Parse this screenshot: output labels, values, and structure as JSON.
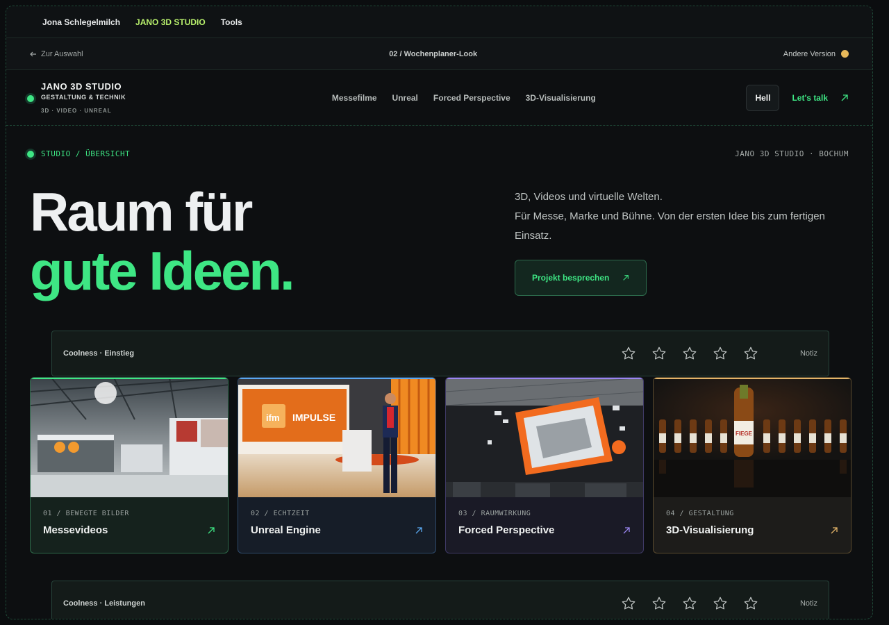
{
  "topbar": {
    "item1": "Jona Schlegelmilch",
    "item2": "JANO 3D STUDIO",
    "item3": "Tools"
  },
  "verbar": {
    "back": "Zur Auswahl",
    "title": "02 / Wochenplaner-Look",
    "version": "Andere Version"
  },
  "brand": {
    "name": "JANO 3D STUDIO",
    "sub": "GESTALTUNG & TECHNIK",
    "tags": "3D · VIDEO · UNREAL"
  },
  "nav": [
    "Messefilme",
    "Unreal",
    "Forced Perspective",
    "3D-Visualisierung"
  ],
  "header": {
    "theme_label": "Hell",
    "cta": "Let's talk"
  },
  "section": {
    "left": "STUDIO / ÜBERSICHT",
    "right": "JANO 3D STUDIO · BOCHUM"
  },
  "hero": {
    "line1": "Raum für",
    "line2": "gute Ideen.",
    "lead1": "3D, Videos und virtuelle Welten.",
    "lead2": "Für Messe, Marke und Bühne. Von der ersten Idee bis zum fertigen Einsatz.",
    "cta": "Projekt besprechen"
  },
  "rating1": {
    "label": "Coolness · Einstieg",
    "note": "Notiz",
    "stars": 0
  },
  "rating2": {
    "label": "Coolness · Leistungen",
    "note": "Notiz",
    "stars": 0
  },
  "cards": [
    {
      "kicker": "01 / BEWEGTE BILDER",
      "title": "Messevideos",
      "accent": "#3ee684"
    },
    {
      "kicker": "02 / ECHTZEIT",
      "title": "Unreal Engine",
      "accent": "#5aa8f0"
    },
    {
      "kicker": "03 / RAUMWIRKUNG",
      "title": "Forced Perspective",
      "accent": "#9a86f0"
    },
    {
      "kicker": "04 / GESTALTUNG",
      "title": "3D-Visualisierung",
      "accent": "#e3b469"
    }
  ],
  "images": {
    "impulse_sign": "IMPULSE",
    "ifm_logo": "ifm",
    "beer_label": "FIEGE"
  }
}
